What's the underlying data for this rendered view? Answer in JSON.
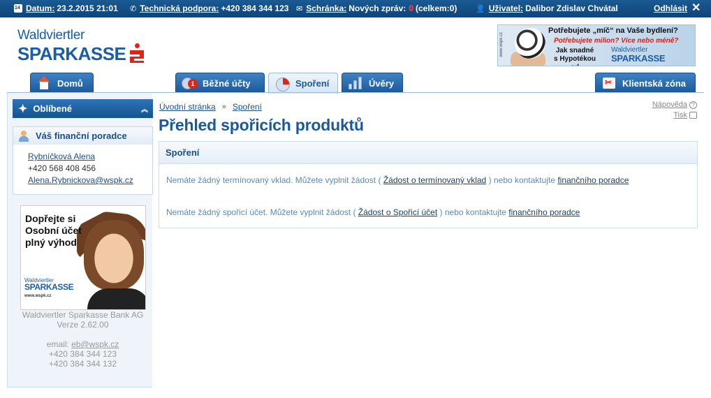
{
  "topbar": {
    "date_label": "Datum:",
    "date_value": "23.2.2015 21:01",
    "support_label": "Technická podpora:",
    "support_value": "+420 384 344 123",
    "inbox_label": "Schránka:",
    "inbox_text": "Nových zpráv:",
    "inbox_new": "0",
    "inbox_total": "(celkem:0)",
    "user_label": "Uživatel:",
    "user_value": "Dalibor Zdislav Chvátal",
    "logout_label": "Odhlásit"
  },
  "logo": {
    "line1": "Waldviertler",
    "line2": "SPARKASSE"
  },
  "banner": {
    "side_text": "www.wspk.cz",
    "headline": "Potřebujete „míč“ na Vaše bydlení?",
    "subline": "Potřebujete milion? Více nebo méně?",
    "line3": "Jak snadné s Hypotékou od",
    "logo_line1": "Waldviertler",
    "logo_line2": "SPARKASSE"
  },
  "tabs": [
    {
      "label": "Domů",
      "icon": "home-icon"
    },
    {
      "label": "Běžné účty",
      "icon": "coins-icon",
      "badge": "1"
    },
    {
      "label": "Spoření",
      "icon": "pie-chart-icon",
      "active": true
    },
    {
      "label": "Úvěry",
      "icon": "bar-chart-icon"
    },
    {
      "label": "Klientská zóna",
      "icon": "key-icon"
    }
  ],
  "sidebar": {
    "favorites_label": "Oblíbené",
    "advisor_heading": "Váš finanční poradce",
    "advisor_name": "Rybníčková Alena",
    "advisor_phone": "+420 568 408 456",
    "advisor_email": "Alena.Rybnickova@wspk.cz",
    "promo_text_1": "Dopřejte si",
    "promo_text_2": "Osobní účet",
    "promo_text_3": "plný výhod",
    "promo_logo_1": "Waldviertler",
    "promo_logo_2": "SPARKASSE",
    "promo_url": "www.wspk.cz",
    "bank_name": "Waldviertler Sparkasse Bank AG",
    "version": "Verze 2.62.00",
    "email_label": "email:",
    "email_value": "eb@wspk.cz",
    "phone_1": "+420 384 344 123",
    "phone_2": "+420 384 344 132"
  },
  "breadcrumb": {
    "home": "Úvodní stránka",
    "sep": "»",
    "current": "Spoření"
  },
  "help": {
    "help_label": "Nápověda",
    "print_label": "Tisk"
  },
  "page_title": "Přehled spořicích produktů",
  "savings": {
    "heading": "Spoření",
    "row1_text_a": "Nemáte žádný termínovaný vklad. Můžete vyplnit žádost (",
    "row1_link": "Žádost o termínovaný vklad",
    "row1_text_b": ") nebo kontaktujte",
    "row1_contact": "finančního poradce",
    "row2_text_a": "Nemáte žádný spořicí účet. Můžete vyplnit žádost (",
    "row2_link": "Žádost o Spořicí účet",
    "row2_text_b": ") nebo kontaktujte",
    "row2_contact": "finančního poradce"
  }
}
